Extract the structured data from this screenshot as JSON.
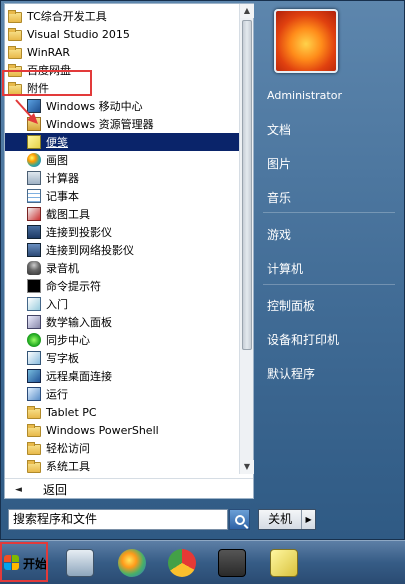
{
  "programs": [
    {
      "label": "TC综合开发工具",
      "icon": "folder-icon",
      "level": 0
    },
    {
      "label": "Visual Studio 2015",
      "icon": "folder-icon",
      "level": 0
    },
    {
      "label": "WinRAR",
      "icon": "folder-icon",
      "level": 0
    },
    {
      "label": "百度网盘",
      "icon": "folder-icon",
      "level": 0
    },
    {
      "label": "附件",
      "icon": "folder-icon",
      "level": 0
    },
    {
      "label": "Windows 移动中心",
      "icon": "mobility-center-icon",
      "level": 1
    },
    {
      "label": "Windows 资源管理器",
      "icon": "explorer-icon",
      "level": 1
    },
    {
      "label": "便笺",
      "icon": "sticky-notes-icon",
      "level": 1,
      "selected": true
    },
    {
      "label": "画图",
      "icon": "paint-icon",
      "level": 1
    },
    {
      "label": "计算器",
      "icon": "calculator-icon",
      "level": 1
    },
    {
      "label": "记事本",
      "icon": "notepad-icon",
      "level": 1
    },
    {
      "label": "截图工具",
      "icon": "snipping-tool-icon",
      "level": 1
    },
    {
      "label": "连接到投影仪",
      "icon": "projector-icon",
      "level": 1
    },
    {
      "label": "连接到网络投影仪",
      "icon": "network-projector-icon",
      "level": 1
    },
    {
      "label": "录音机",
      "icon": "microphone-icon",
      "level": 1
    },
    {
      "label": "命令提示符",
      "icon": "command-prompt-icon",
      "level": 1
    },
    {
      "label": "入门",
      "icon": "getting-started-icon",
      "level": 1
    },
    {
      "label": "数学输入面板",
      "icon": "math-input-icon",
      "level": 1
    },
    {
      "label": "同步中心",
      "icon": "sync-center-icon",
      "level": 1
    },
    {
      "label": "写字板",
      "icon": "wordpad-icon",
      "level": 1
    },
    {
      "label": "远程桌面连接",
      "icon": "remote-desktop-icon",
      "level": 1
    },
    {
      "label": "运行",
      "icon": "run-icon",
      "level": 1
    },
    {
      "label": "Tablet PC",
      "icon": "folder-icon",
      "level": 1
    },
    {
      "label": "Windows PowerShell",
      "icon": "folder-icon",
      "level": 1
    },
    {
      "label": "轻松访问",
      "icon": "folder-icon",
      "level": 1
    },
    {
      "label": "系统工具",
      "icon": "folder-icon",
      "level": 1
    }
  ],
  "left_pane": {
    "back_label": "返回"
  },
  "search": {
    "placeholder": "搜索程序和文件"
  },
  "right_pane": {
    "user": "Administrator",
    "items": [
      "文档",
      "图片",
      "音乐",
      "游戏",
      "计算机",
      "控制面板",
      "设备和打印机",
      "默认程序"
    ]
  },
  "shutdown": {
    "label": "关机"
  },
  "taskbar": {
    "start_label": "开始",
    "buttons": [
      "calculator-icon",
      "paint-icon",
      "chrome-icon",
      "sublime-text-icon",
      "sticky-notes-icon"
    ]
  },
  "colors": {
    "selection": "#0a246a",
    "highlight_box": "#e23a3a",
    "menu_gradient_top": "#5d86ad",
    "taskbar_top": "#5d7fa6"
  }
}
